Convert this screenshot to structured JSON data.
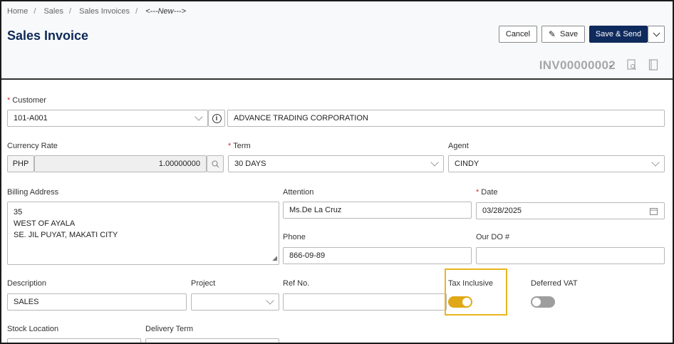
{
  "breadcrumb": [
    "Home",
    "Sales",
    "Sales Invoices",
    "<---New--->"
  ],
  "page_title": "Sales Invoice",
  "toolbar": {
    "cancel": "Cancel",
    "save": "Save",
    "save_send": "Save & Send"
  },
  "invoice_number": "INV00000002",
  "customer": {
    "label": "Customer",
    "code": "101-A001",
    "name": "ADVANCE TRADING CORPORATION"
  },
  "currency": {
    "label": "Currency Rate",
    "code": "PHP",
    "rate": "1.00000000"
  },
  "term": {
    "label": "Term",
    "value": "30 DAYS"
  },
  "agent": {
    "label": "Agent",
    "value": "CINDY"
  },
  "billing": {
    "label": "Billing Address",
    "lines": [
      "35",
      "WEST OF AYALA",
      "SE. JIL PUYAT, MAKATI CITY"
    ]
  },
  "attention": {
    "label": "Attention",
    "value": "Ms.De La Cruz"
  },
  "date": {
    "label": "Date",
    "value": "03/28/2025"
  },
  "phone": {
    "label": "Phone",
    "value": "866-09-89"
  },
  "our_do": {
    "label": "Our DO #",
    "value": ""
  },
  "description": {
    "label": "Description",
    "value": "SALES"
  },
  "project": {
    "label": "Project",
    "value": ""
  },
  "ref_no": {
    "label": "Ref No.",
    "value": ""
  },
  "tax_inclusive": {
    "label": "Tax Inclusive",
    "on": true
  },
  "deferred_vat": {
    "label": "Deferred VAT",
    "on": false
  },
  "stock_location": {
    "label": "Stock Location"
  },
  "delivery_term": {
    "label": "Delivery Term"
  },
  "colors": {
    "brand": "#0f2a5c",
    "toggle_on": "#e0a817",
    "toggle_off": "#9e9e9e",
    "highlight": "#e8b51e",
    "required": "#d23030"
  }
}
